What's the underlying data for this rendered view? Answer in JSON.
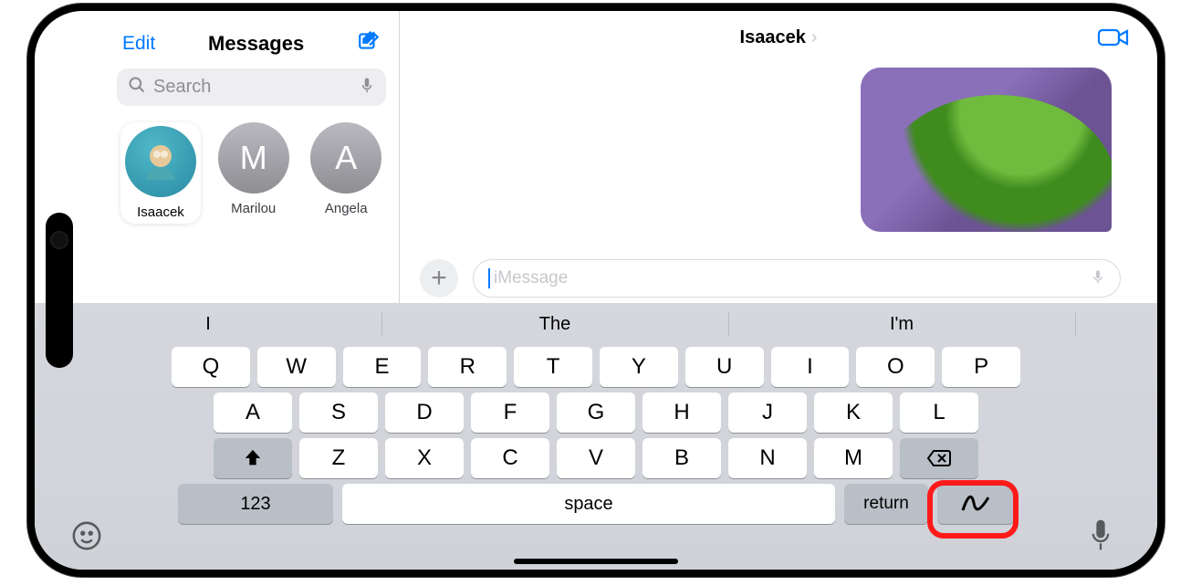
{
  "sidebar": {
    "edit": "Edit",
    "title": "Messages",
    "search_placeholder": "Search",
    "pins": [
      {
        "name": "Isaacek",
        "initial": ""
      },
      {
        "name": "Marilou",
        "initial": "M"
      },
      {
        "name": "Angela",
        "initial": "A"
      }
    ]
  },
  "conversation": {
    "title": "Isaacek",
    "input_placeholder": "iMessage"
  },
  "suggestions": [
    "I",
    "The",
    "I'm"
  ],
  "keyboard": {
    "row1": [
      "Q",
      "W",
      "E",
      "R",
      "T",
      "Y",
      "U",
      "I",
      "O",
      "P"
    ],
    "row2": [
      "A",
      "S",
      "D",
      "F",
      "G",
      "H",
      "J",
      "K",
      "L"
    ],
    "row3": [
      "Z",
      "X",
      "C",
      "V",
      "B",
      "N",
      "M"
    ],
    "numbers_label": "123",
    "space_label": "space",
    "return_label": "return"
  },
  "icons": {
    "compose": "compose-icon",
    "search": "search-icon",
    "mic": "mic-icon",
    "facetime": "video-icon",
    "plus": "plus-icon",
    "shift": "shift-icon",
    "backspace": "backspace-icon",
    "handwriting": "handwriting-icon",
    "emoji": "emoji-icon",
    "dictation": "dictation-icon",
    "text_format": "text-format-icon"
  },
  "colors": {
    "accent": "#007aff",
    "highlight": "#ff1a1a"
  }
}
